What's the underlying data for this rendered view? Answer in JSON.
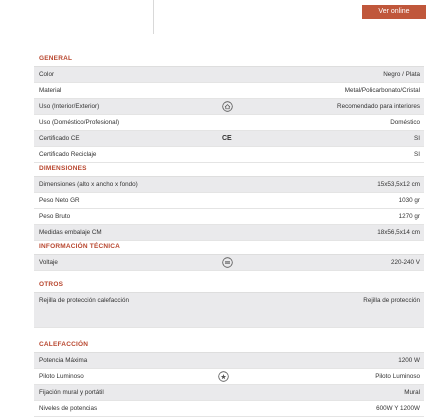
{
  "header": {
    "button": "Ver online"
  },
  "sections": {
    "general": {
      "title": "GENERAL",
      "rows": [
        {
          "label": "Color",
          "value": "Negro / Plata"
        },
        {
          "label": "Material",
          "value": "Metal/Policarbonato/Cristal"
        },
        {
          "label": "Uso (Interior/Exterior)",
          "value": "Recomendado para interiores",
          "icon": "home-icon"
        },
        {
          "label": "Uso (Doméstico/Profesional)",
          "value": "Doméstico"
        },
        {
          "label": "Certificado CE",
          "value": "SI",
          "icon": "ce-mark-icon",
          "icon_text": "CE"
        },
        {
          "label": "Certificado Reciclaje",
          "value": "SI"
        }
      ]
    },
    "dimensiones": {
      "title": "DIMENSIONES",
      "rows": [
        {
          "label": "Dimensiones (alto x ancho x fondo)",
          "value": "15x53,5x12 cm"
        },
        {
          "label": "Peso Neto GR",
          "value": "1030 gr"
        },
        {
          "label": "Peso Bruto",
          "value": "1270 gr"
        },
        {
          "label": "Medidas embalaje CM",
          "value": "18x56,5x14 cm"
        }
      ]
    },
    "tecnica": {
      "title": "INFORMACIÓN TÉCNICA",
      "rows": [
        {
          "label": "Voltaje",
          "value": "220-240 V",
          "icon": "voltage-icon"
        }
      ]
    },
    "otros": {
      "title": "OTROS",
      "rows": [
        {
          "label": "Rejilla de protección calefacción",
          "value": "Rejilla de protección"
        }
      ]
    },
    "calefaccion": {
      "title": "CALEFACCIÓN",
      "rows": [
        {
          "label": "Potencia Máxima",
          "value": "1200 W"
        },
        {
          "label": "Piloto Luminoso",
          "value": "Piloto Luminoso",
          "icon": "pilot-light-icon"
        },
        {
          "label": "Fijación mural y portátil",
          "value": "Mural"
        },
        {
          "label": "Niveles de potencias",
          "value": "600W Y 1200W"
        }
      ]
    }
  }
}
